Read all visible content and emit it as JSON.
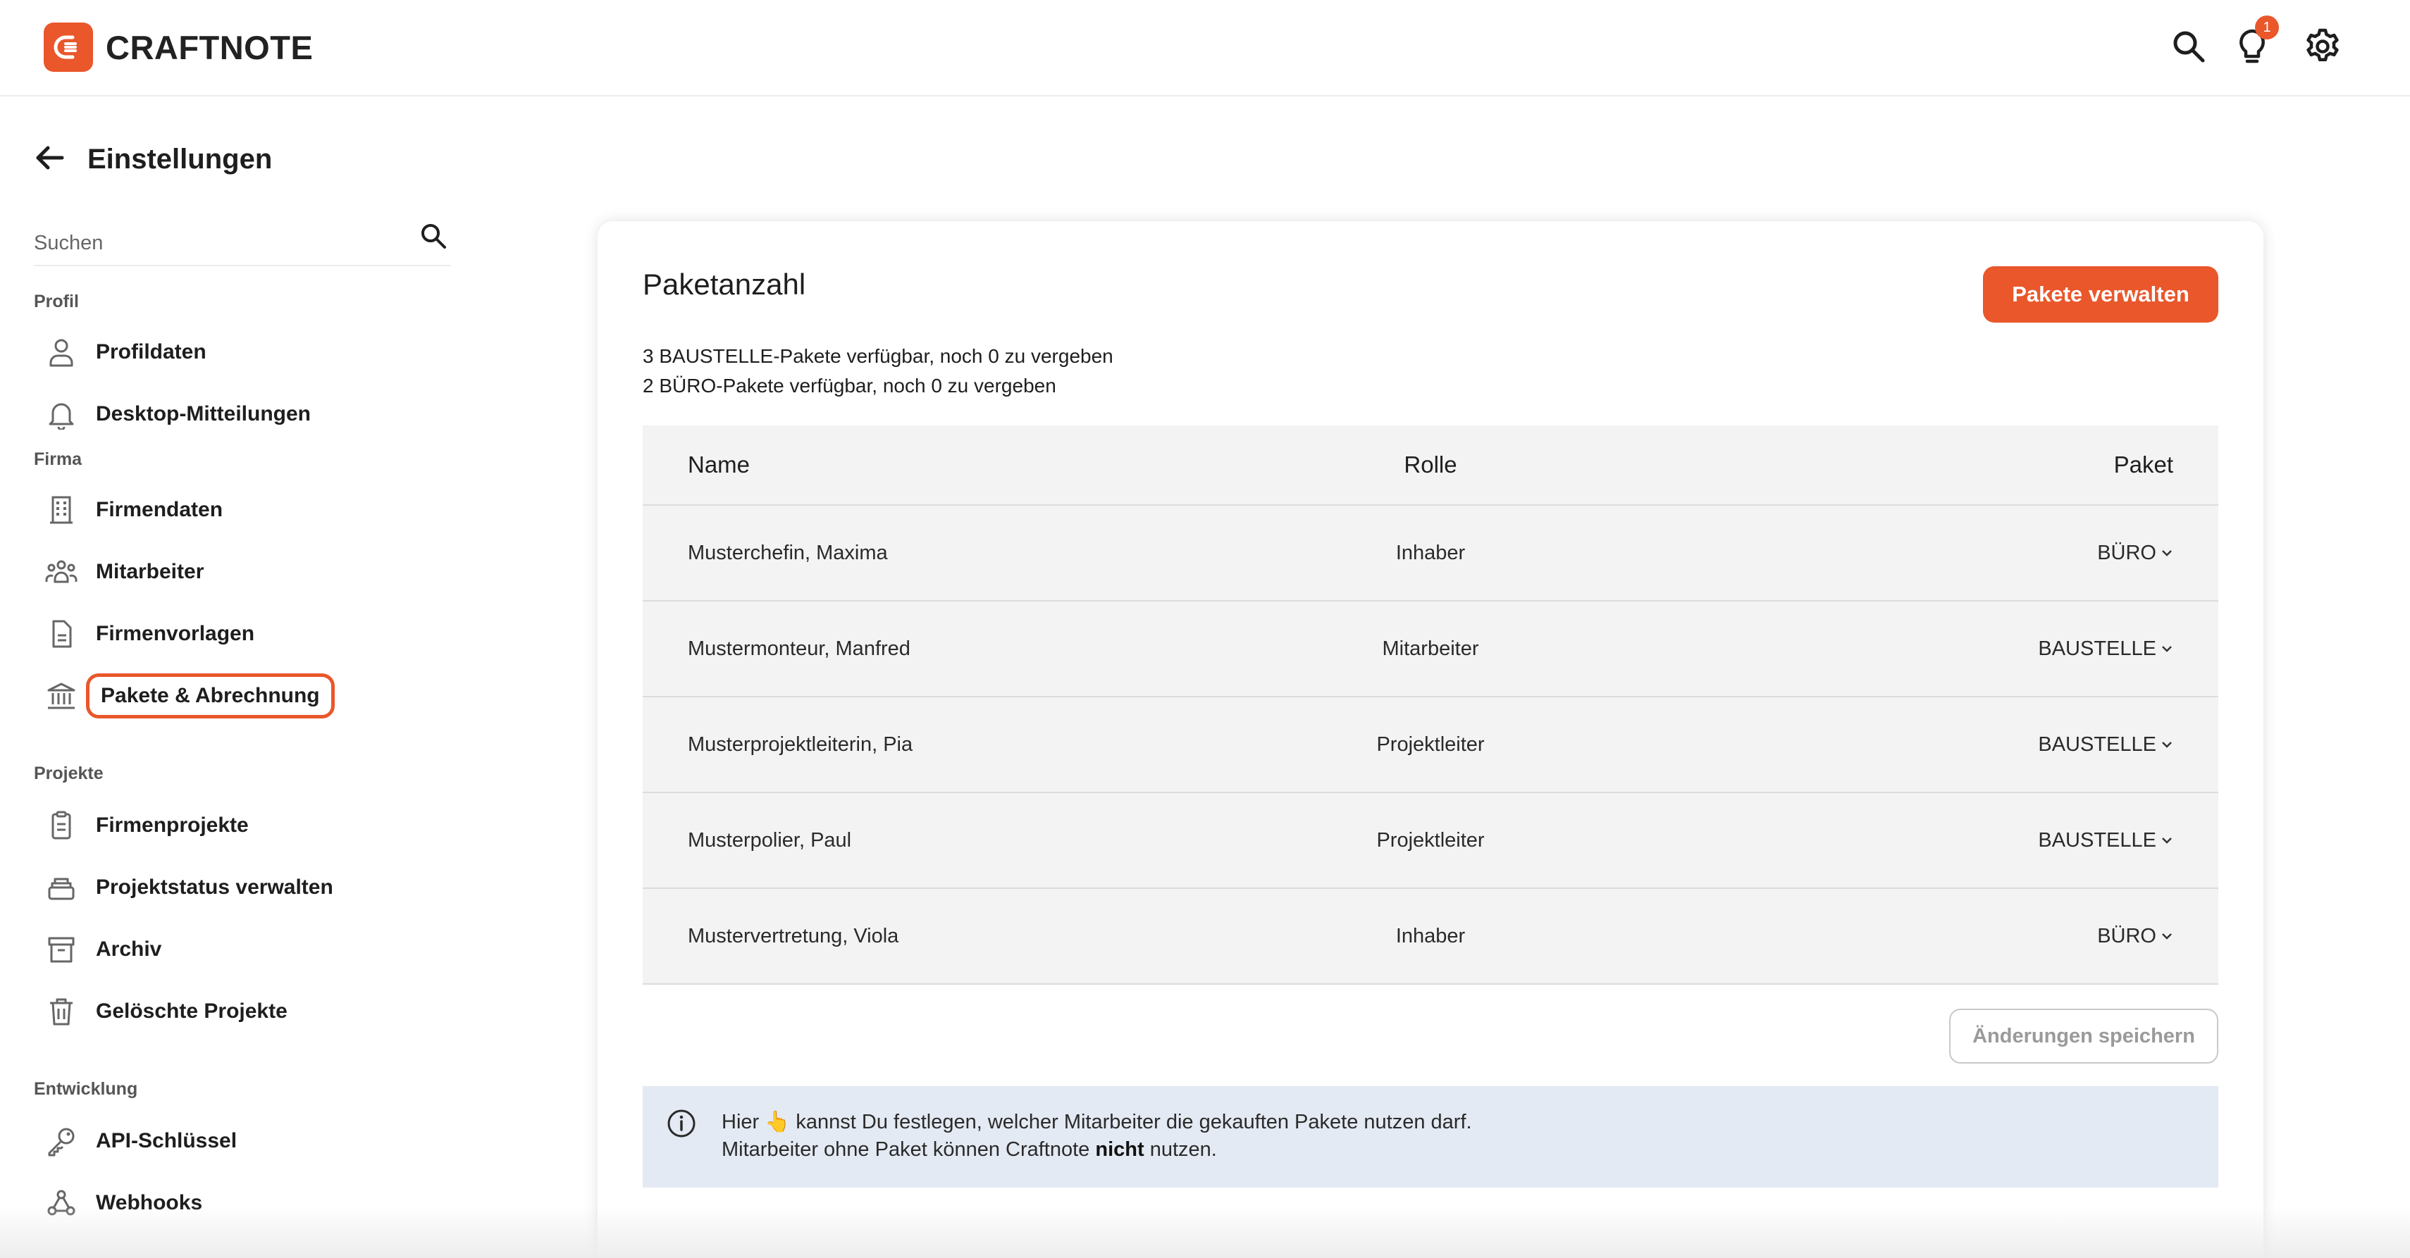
{
  "app": {
    "name": "CRAFTNOTE",
    "notification_count": "1"
  },
  "page": {
    "title": "Einstellungen"
  },
  "sidebar": {
    "search_placeholder": "Suchen",
    "sections": {
      "profil": "Profil",
      "firma": "Firma",
      "projekte": "Projekte",
      "entwicklung": "Entwicklung"
    },
    "items": {
      "profildaten": "Profildaten",
      "desktop": "Desktop-Mitteilungen",
      "firmendaten": "Firmendaten",
      "mitarbeiter": "Mitarbeiter",
      "firmenvorlagen": "Firmenvorlagen",
      "pakete": "Pakete & Abrechnung",
      "firmenprojekte": "Firmenprojekte",
      "projektstatus": "Projektstatus verwalten",
      "archiv": "Archiv",
      "geloescht": "Gelöschte Projekte",
      "api": "API-Schlüssel",
      "webhooks": "Webhooks"
    }
  },
  "main": {
    "title": "Paketanzahl",
    "manage_button": "Pakete verwalten",
    "availability": [
      "3 BAUSTELLE-Pakete verfügbar, noch 0 zu vergeben",
      "2 BÜRO-Pakete verfügbar, noch 0 zu vergeben"
    ],
    "table": {
      "headers": {
        "name": "Name",
        "role": "Rolle",
        "package": "Paket"
      },
      "rows": [
        {
          "name": "Musterchefin, Maxima",
          "role": "Inhaber",
          "package": "BÜRO"
        },
        {
          "name": "Mustermonteur, Manfred",
          "role": "Mitarbeiter",
          "package": "BAUSTELLE"
        },
        {
          "name": "Musterprojektleiterin, Pia",
          "role": "Projektleiter",
          "package": "BAUSTELLE"
        },
        {
          "name": "Musterpolier, Paul",
          "role": "Projektleiter",
          "package": "BAUSTELLE"
        },
        {
          "name": "Mustervertretung, Viola",
          "role": "Inhaber",
          "package": "BÜRO"
        }
      ]
    },
    "save_button": "Änderungen speichern",
    "info": {
      "line1": "Hier 👆 kannst Du festlegen, welcher Mitarbeiter die gekauften Pakete nutzen darf.",
      "line2_before": "Mitarbeiter ohne Paket können Craftnote ",
      "line2_bold": "nicht",
      "line2_after": " nutzen."
    }
  },
  "colors": {
    "accent": "#e9572b",
    "info_bg": "#e4eaf3",
    "row_bg": "#f3f3f3"
  }
}
